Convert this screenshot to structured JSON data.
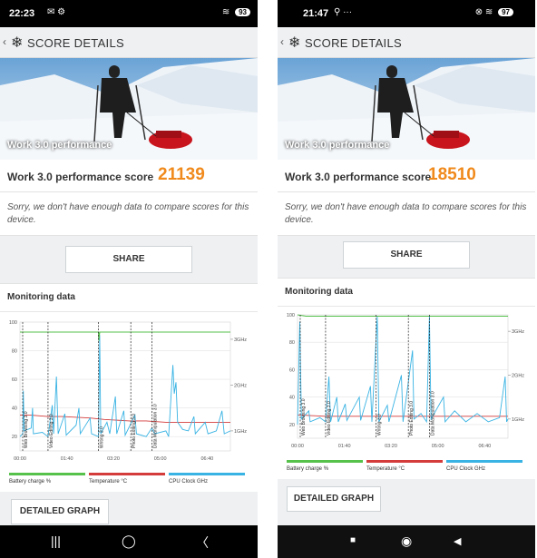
{
  "left": {
    "status": {
      "time": "22:23",
      "left_icons": "✉ ⚙",
      "right_icons": "WiFi ▮",
      "battery": "93"
    },
    "header": {
      "title": "SCORE DETAILS"
    },
    "hero": {
      "label": "Work 3.0 performance"
    },
    "score": {
      "label": "Work 3.0 performance score",
      "value": "21139"
    },
    "note": "Sorry, we don't have enough data to compare scores for this device.",
    "share_label": "SHARE",
    "monitoring_title": "Monitoring data",
    "chart_data": {
      "type": "line",
      "y_ticks": [
        "100",
        "80",
        "60",
        "40",
        "20"
      ],
      "right_ticks": [
        "3GHz",
        "2GHz",
        "1GHz"
      ],
      "x_ticks": [
        "00:00",
        "01:40",
        "03:20",
        "05:00",
        "06:40"
      ],
      "segments": [
        "Web Browsing 3.0",
        "Video Editing 3.0",
        "Writing 3.0",
        "Photo Editing 3.0",
        "Data Manipulation 3.0"
      ],
      "battery": [
        {
          "x": 0,
          "y": 93
        },
        {
          "x": 280,
          "y": 93
        },
        {
          "x": 281,
          "y": 87
        },
        {
          "x": 284,
          "y": 93
        },
        {
          "x": 750,
          "y": 93
        }
      ],
      "temperature": [
        {
          "x": 0,
          "y": 35
        },
        {
          "x": 40,
          "y": 35
        },
        {
          "x": 100,
          "y": 34
        },
        {
          "x": 150,
          "y": 34
        },
        {
          "x": 250,
          "y": 33
        },
        {
          "x": 300,
          "y": 32
        },
        {
          "x": 390,
          "y": 31
        },
        {
          "x": 450,
          "y": 31
        },
        {
          "x": 520,
          "y": 30
        },
        {
          "x": 600,
          "y": 30
        },
        {
          "x": 750,
          "y": 30
        }
      ],
      "cpu": [
        {
          "x": 0,
          "y": 20
        },
        {
          "x": 10,
          "y": 22
        },
        {
          "x": 12,
          "y": 52
        },
        {
          "x": 15,
          "y": 24
        },
        {
          "x": 40,
          "y": 26
        },
        {
          "x": 45,
          "y": 40
        },
        {
          "x": 48,
          "y": 22
        },
        {
          "x": 80,
          "y": 23
        },
        {
          "x": 100,
          "y": 20
        },
        {
          "x": 115,
          "y": 42
        },
        {
          "x": 120,
          "y": 22
        },
        {
          "x": 130,
          "y": 62
        },
        {
          "x": 136,
          "y": 22
        },
        {
          "x": 160,
          "y": 36
        },
        {
          "x": 165,
          "y": 21
        },
        {
          "x": 200,
          "y": 28
        },
        {
          "x": 210,
          "y": 40
        },
        {
          "x": 215,
          "y": 22
        },
        {
          "x": 250,
          "y": 33
        },
        {
          "x": 255,
          "y": 22
        },
        {
          "x": 280,
          "y": 20
        },
        {
          "x": 284,
          "y": 91
        },
        {
          "x": 288,
          "y": 22
        },
        {
          "x": 310,
          "y": 30
        },
        {
          "x": 320,
          "y": 22
        },
        {
          "x": 340,
          "y": 48
        },
        {
          "x": 345,
          "y": 22
        },
        {
          "x": 370,
          "y": 38
        },
        {
          "x": 375,
          "y": 21
        },
        {
          "x": 410,
          "y": 35
        },
        {
          "x": 415,
          "y": 22
        },
        {
          "x": 450,
          "y": 20
        },
        {
          "x": 470,
          "y": 26
        },
        {
          "x": 480,
          "y": 22
        },
        {
          "x": 520,
          "y": 24
        },
        {
          "x": 530,
          "y": 20
        },
        {
          "x": 545,
          "y": 70
        },
        {
          "x": 550,
          "y": 50
        },
        {
          "x": 556,
          "y": 58
        },
        {
          "x": 562,
          "y": 30
        },
        {
          "x": 580,
          "y": 25
        },
        {
          "x": 600,
          "y": 24
        },
        {
          "x": 620,
          "y": 34
        },
        {
          "x": 625,
          "y": 22
        },
        {
          "x": 660,
          "y": 30
        },
        {
          "x": 670,
          "y": 22
        },
        {
          "x": 700,
          "y": 24
        },
        {
          "x": 720,
          "y": 38
        },
        {
          "x": 728,
          "y": 22
        },
        {
          "x": 750,
          "y": 24
        }
      ],
      "markers": [
        0,
        100,
        280,
        395,
        470
      ],
      "x_range": [
        0,
        750
      ],
      "y_range": [
        10,
        100
      ],
      "colors": {
        "battery": "#56c14b",
        "temperature": "#d43b3b",
        "cpu": "#39b3e3"
      }
    },
    "legend": {
      "battery": "Battery charge %",
      "temperature": "Temperature °C",
      "cpu": "CPU Clock GHz"
    },
    "detailed_label": "DETAILED GRAPH",
    "nav": {
      "recent": "|||",
      "home": "◯",
      "back": "〈"
    }
  },
  "right": {
    "status": {
      "time": "21:47",
      "left_icons": "⚲ ···",
      "right_icons": "✕ WiFi",
      "battery": "97"
    },
    "header": {
      "title": "SCORE DETAILS"
    },
    "hero": {
      "label": "Work 3.0 performance"
    },
    "score": {
      "label": "Work 3.0 performance score",
      "value": "18510"
    },
    "note": "Sorry, we don't have enough data to compare scores for this device.",
    "share_label": "SHARE",
    "monitoring_title": "Monitoring data",
    "chart_data": {
      "type": "line",
      "y_ticks": [
        "100",
        "80",
        "60",
        "40",
        "20"
      ],
      "right_ticks": [
        "3GHz",
        "2GHz",
        "1GHz"
      ],
      "x_ticks": [
        "00:00",
        "01:40",
        "03:20",
        "05:00",
        "06:40"
      ],
      "segments": [
        "Web Browsing 3.0",
        "Video Editing 3.0",
        "Writing 3.0",
        "Photo Editing 3.0",
        "Data Manipulation 3.0"
      ],
      "battery": [
        {
          "x": 0,
          "y": 100
        },
        {
          "x": 30,
          "y": 99
        },
        {
          "x": 750,
          "y": 99
        }
      ],
      "temperature": [
        {
          "x": 0,
          "y": 27
        },
        {
          "x": 100,
          "y": 26
        },
        {
          "x": 300,
          "y": 26
        },
        {
          "x": 500,
          "y": 26
        },
        {
          "x": 750,
          "y": 26
        }
      ],
      "cpu": [
        {
          "x": 0,
          "y": 20
        },
        {
          "x": 8,
          "y": 95
        },
        {
          "x": 14,
          "y": 24
        },
        {
          "x": 40,
          "y": 30
        },
        {
          "x": 45,
          "y": 22
        },
        {
          "x": 80,
          "y": 25
        },
        {
          "x": 100,
          "y": 22
        },
        {
          "x": 112,
          "y": 55
        },
        {
          "x": 118,
          "y": 22
        },
        {
          "x": 140,
          "y": 40
        },
        {
          "x": 145,
          "y": 22
        },
        {
          "x": 170,
          "y": 35
        },
        {
          "x": 176,
          "y": 23
        },
        {
          "x": 220,
          "y": 40
        },
        {
          "x": 225,
          "y": 23
        },
        {
          "x": 260,
          "y": 48
        },
        {
          "x": 265,
          "y": 22
        },
        {
          "x": 284,
          "y": 99
        },
        {
          "x": 290,
          "y": 22
        },
        {
          "x": 320,
          "y": 34
        },
        {
          "x": 326,
          "y": 22
        },
        {
          "x": 370,
          "y": 56
        },
        {
          "x": 376,
          "y": 22
        },
        {
          "x": 410,
          "y": 74
        },
        {
          "x": 415,
          "y": 24
        },
        {
          "x": 440,
          "y": 28
        },
        {
          "x": 460,
          "y": 22
        },
        {
          "x": 470,
          "y": 99
        },
        {
          "x": 476,
          "y": 24
        },
        {
          "x": 520,
          "y": 40
        },
        {
          "x": 526,
          "y": 22
        },
        {
          "x": 560,
          "y": 30
        },
        {
          "x": 600,
          "y": 22
        },
        {
          "x": 640,
          "y": 28
        },
        {
          "x": 680,
          "y": 22
        },
        {
          "x": 720,
          "y": 25
        },
        {
          "x": 740,
          "y": 55
        },
        {
          "x": 745,
          "y": 22
        },
        {
          "x": 750,
          "y": 24
        }
      ],
      "markers": [
        0,
        100,
        280,
        395,
        470
      ],
      "x_range": [
        0,
        750
      ],
      "y_range": [
        10,
        100
      ],
      "colors": {
        "battery": "#56c14b",
        "temperature": "#d43b3b",
        "cpu": "#39b3e3"
      }
    },
    "legend": {
      "battery": "Battery charge %",
      "temperature": "Temperature °C",
      "cpu": "CPU Clock GHz"
    },
    "detailed_label": "DETAILED GRAPH",
    "nav": {
      "recent": "■",
      "home": "◉",
      "back": "◀"
    }
  }
}
